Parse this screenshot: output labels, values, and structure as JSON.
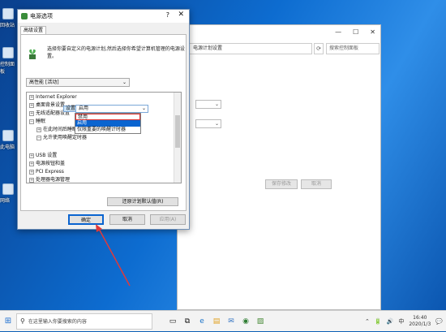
{
  "desktop": {
    "icon_labels": [
      "回收站",
      "控制面板",
      "此电脑",
      "网络"
    ]
  },
  "background_window": {
    "address": "电源计划设置",
    "search_placeholder": "搜索控制面板",
    "buttons": [
      "保存修改",
      "取消"
    ]
  },
  "dialog": {
    "title": "电源选项",
    "help_glyph": "?",
    "close_glyph": "✕",
    "tab_label": "高级设置",
    "description": "选择你要自定义的电源计划,然后选择你希望计算机管理的电源设置。",
    "plan_select": "高性能 [活动]",
    "tree": {
      "items": [
        {
          "label": "Internet Explorer",
          "expander": "+",
          "level": 0
        },
        {
          "label": "桌面背景设置",
          "expander": "+",
          "level": 0
        },
        {
          "label": "无线适配器设置",
          "expander": "+",
          "level": 0
        },
        {
          "label": "睡眠",
          "expander": "−",
          "level": 0
        },
        {
          "label": "在此时间后睡眠",
          "expander": "+",
          "level": 1
        },
        {
          "label": "允许使用唤醒定时器",
          "expander": "−",
          "level": 1
        },
        {
          "label": "USB 设置",
          "expander": "+",
          "level": 0
        },
        {
          "label": "电源按钮和盖",
          "expander": "+",
          "level": 0
        },
        {
          "label": "PCI Express",
          "expander": "+",
          "level": 0
        },
        {
          "label": "处理器电源管理",
          "expander": "+",
          "level": 0
        }
      ],
      "setting_label": "设置",
      "setting_value": "启用",
      "dropdown_options": [
        "禁用",
        "启用",
        "仅限重要的唤醒计时器"
      ]
    },
    "restore_button": "还原计划默认值(R)",
    "ok_button": "确定",
    "cancel_button": "取消",
    "apply_button": "应用(A)"
  },
  "taskbar": {
    "search_placeholder": "在这里输入你要搜索的内容",
    "time": "16:40",
    "date": "2020/1/3",
    "ime": "中",
    "start_glyph": "⊞",
    "search_glyph": "⚲",
    "app_icons": [
      "▭",
      "⧉",
      "e",
      "▤",
      "✉",
      "◉",
      "▨"
    ],
    "tray_icons": [
      "⌃",
      "🔋",
      "🔊",
      "💬"
    ]
  },
  "colors": {
    "accent": "#0a64d0",
    "highlight_box": "#dd3333",
    "arrow": "#e03a3a"
  }
}
